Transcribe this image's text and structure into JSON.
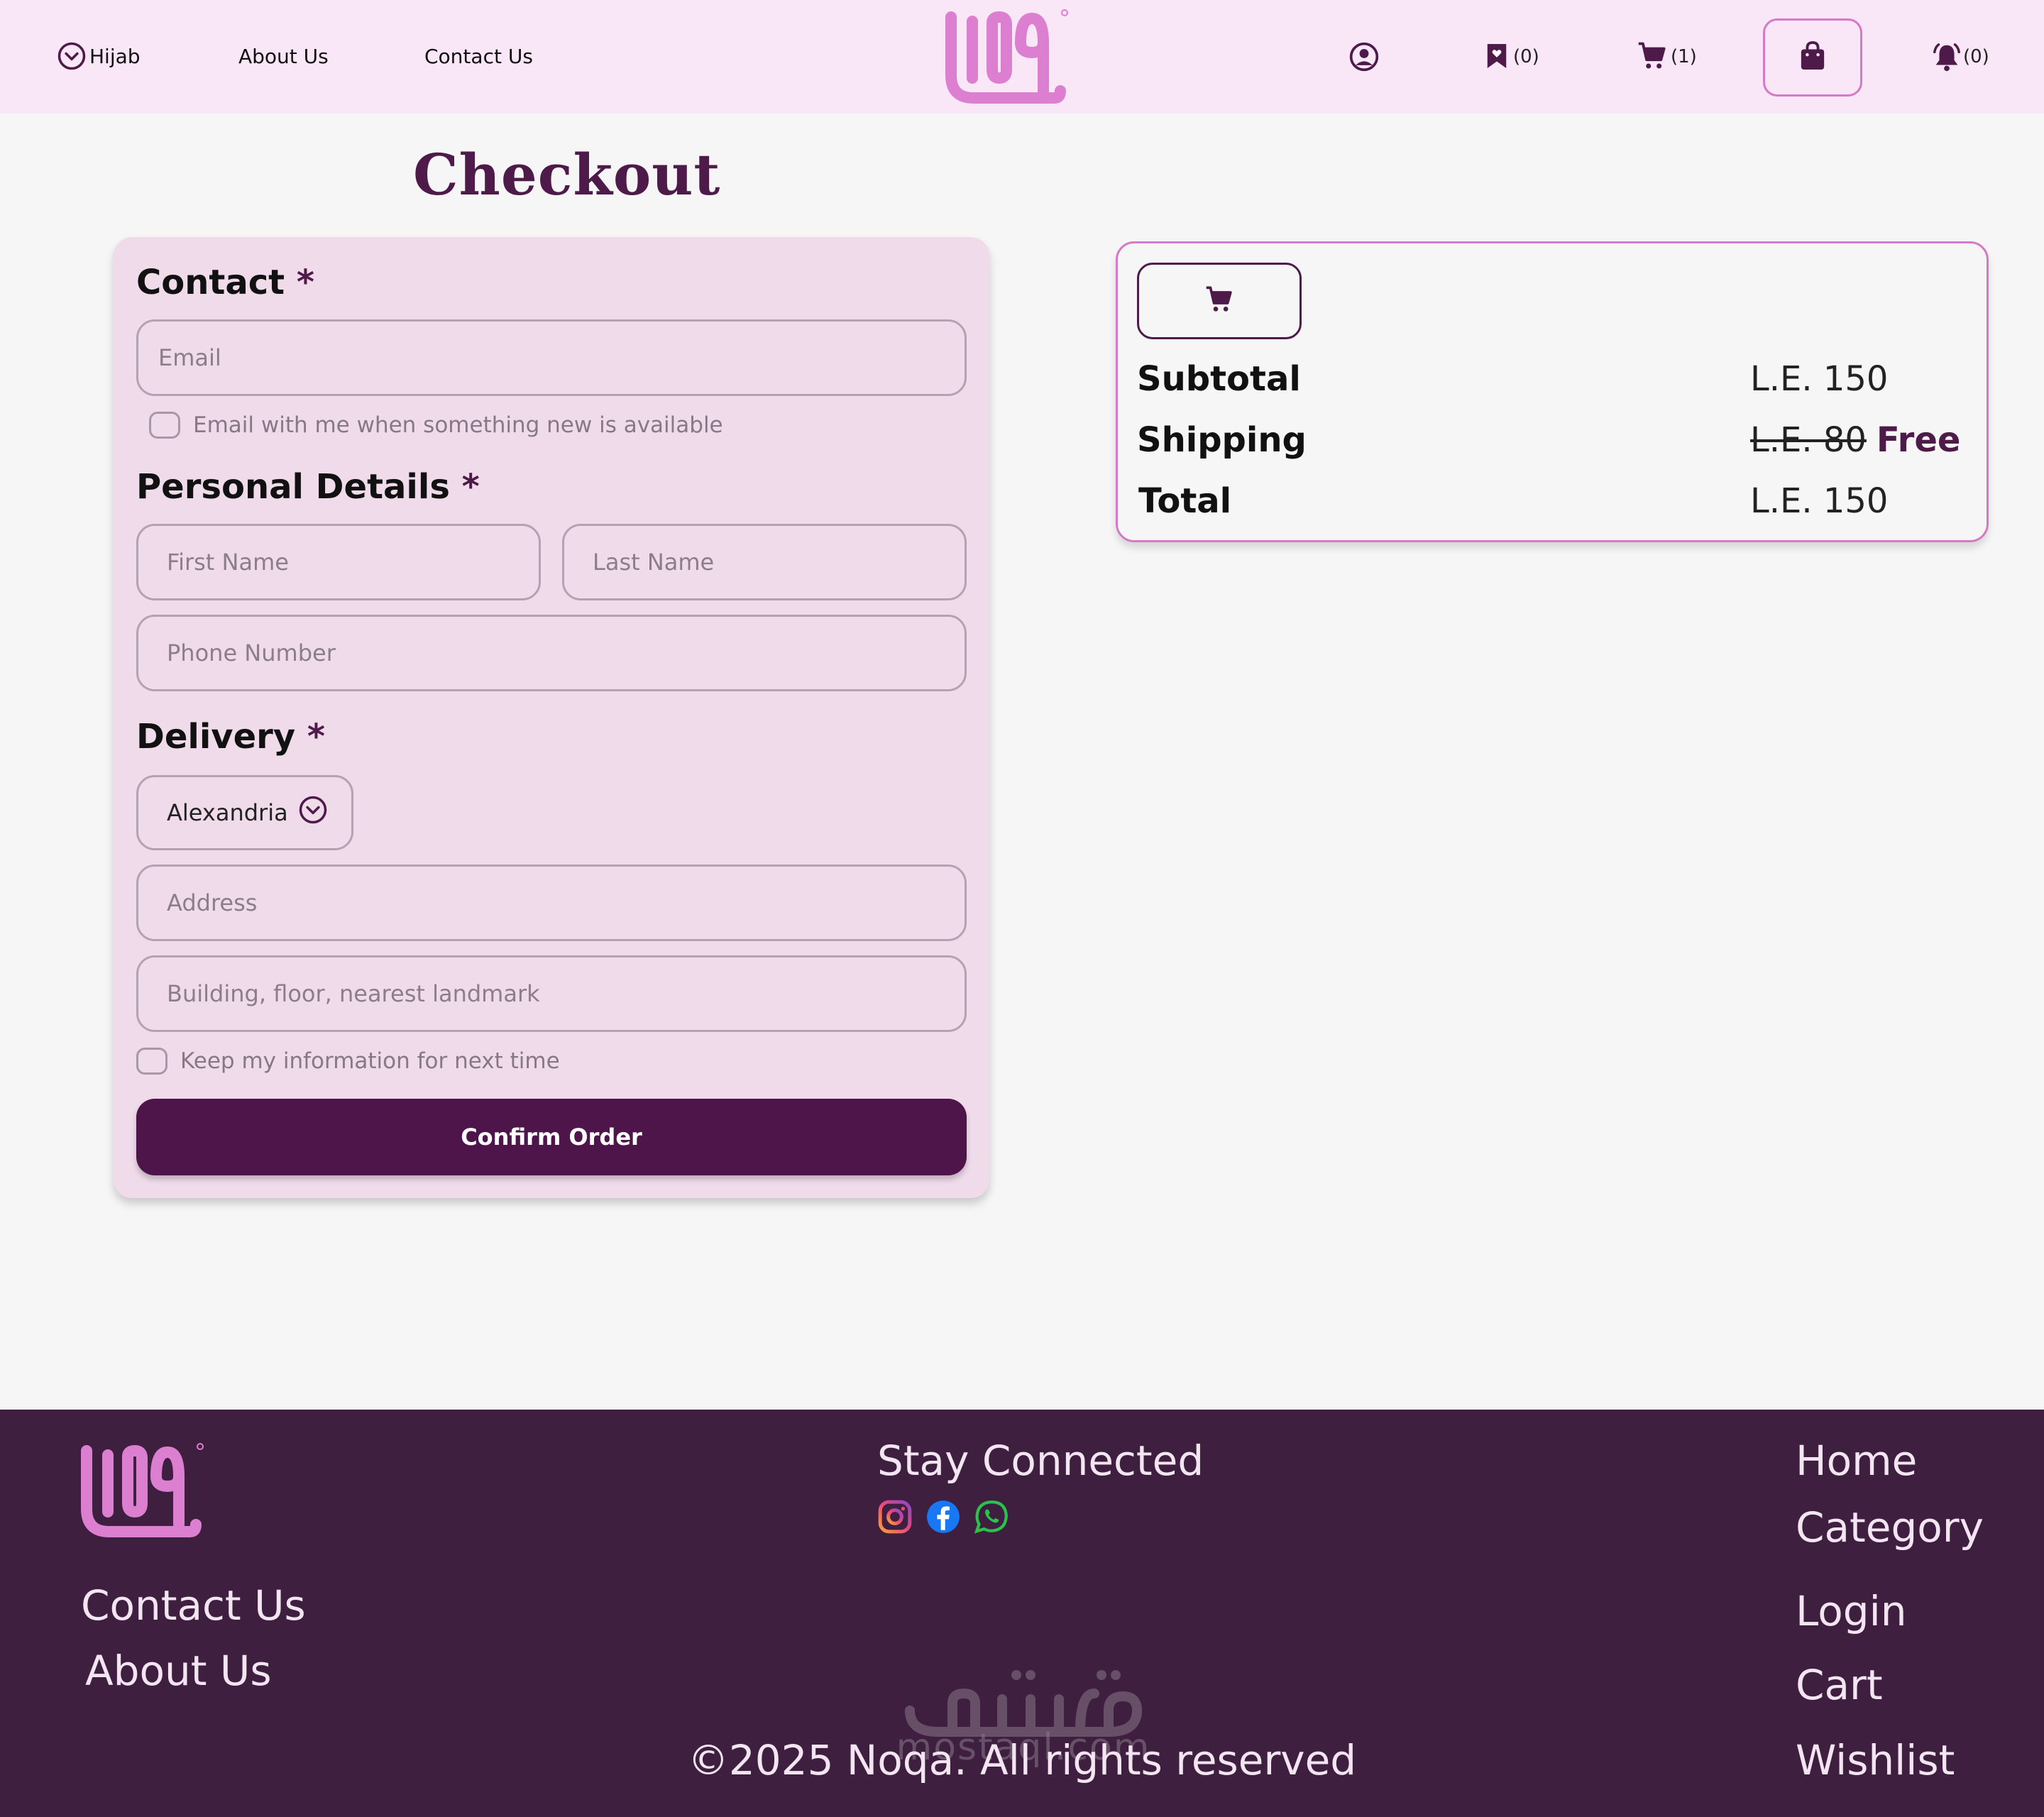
{
  "header": {
    "nav": [
      {
        "label": "Hijab"
      },
      {
        "label": "About Us"
      },
      {
        "label": "Contact Us"
      }
    ],
    "wishlist_count": "(0)",
    "cart_count": "(1)",
    "notifications_count": "(0)"
  },
  "page": {
    "title": "Checkout"
  },
  "form": {
    "contact": {
      "heading": "Contact",
      "star": "*",
      "email_placeholder": "Email",
      "newsletter_label": "Email with me when something new is available"
    },
    "personal": {
      "heading": "Personal Details",
      "star": "*",
      "first_name_placeholder": "First Name",
      "last_name_placeholder": "Last Name",
      "phone_placeholder": "Phone Number"
    },
    "delivery": {
      "heading": "Delivery",
      "star": "*",
      "city_selected": "Alexandria",
      "address_placeholder": "Address",
      "building_placeholder": "Building, floor, nearest landmark"
    },
    "keep_info_label": "Keep my information for next time",
    "confirm_label": "Confirm Order"
  },
  "summary": {
    "subtotal_label": "Subtotal",
    "subtotal_value": "L.E. 150",
    "shipping_label": "Shipping",
    "shipping_old": "L.E. 80",
    "shipping_new": "Free",
    "total_label": "Total",
    "total_value": "L.E. 150"
  },
  "footer": {
    "stay_connected": "Stay Connected",
    "left_links": [
      "Contact Us",
      "About Us"
    ],
    "right_links": [
      "Home",
      "Category",
      "Login",
      "Cart",
      "Wishlist"
    ],
    "copyright": "©2025 Noqa. All rights reserved",
    "watermark": "mostaql.com"
  },
  "colors": {
    "brand": "#4d1a49",
    "logo_pink": "#dc7fd0",
    "header_bg": "#f9e6f6",
    "card_bg": "#f0dbeb",
    "footer_bg": "#3f1f3f"
  }
}
